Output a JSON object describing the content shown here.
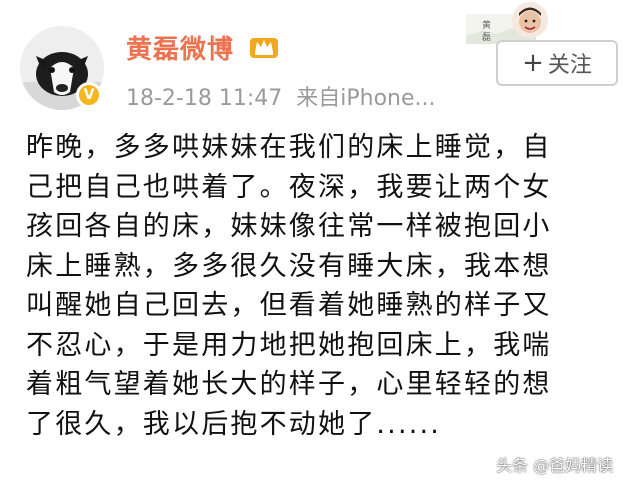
{
  "header": {
    "username": "黄磊微博",
    "timestamp": "18-2-18 11:47",
    "source": "来自iPhone...",
    "follow_label": "关注",
    "follow_plus": "+"
  },
  "post": {
    "lines": [
      "昨晚，多多哄妹妹在我们的床上睡觉，自",
      "己把自己也哄着了。夜深，我要让两个女",
      "孩回各自的床，妹妹像往常一样被抱回小",
      "床上睡熟，多多很久没有睡大床，我本想",
      "叫醒她自己回去，但看着她睡熟的样子又",
      "不忍心，于是用力地把她抱回床上，我喘",
      "着粗气望着她长大的样子，心里轻轻的想",
      "了很久，我以后抱不动她了......"
    ]
  },
  "watermark": "头条 @爸妈精读",
  "colors": {
    "username": "#eb7350",
    "meta": "#9a9a9a",
    "verified": "#f3b61f",
    "crown": "#f0a81e"
  },
  "icons": {
    "avatar": "dog-avatar",
    "verified": "verified-v-icon",
    "crown": "vip-crown-icon"
  }
}
